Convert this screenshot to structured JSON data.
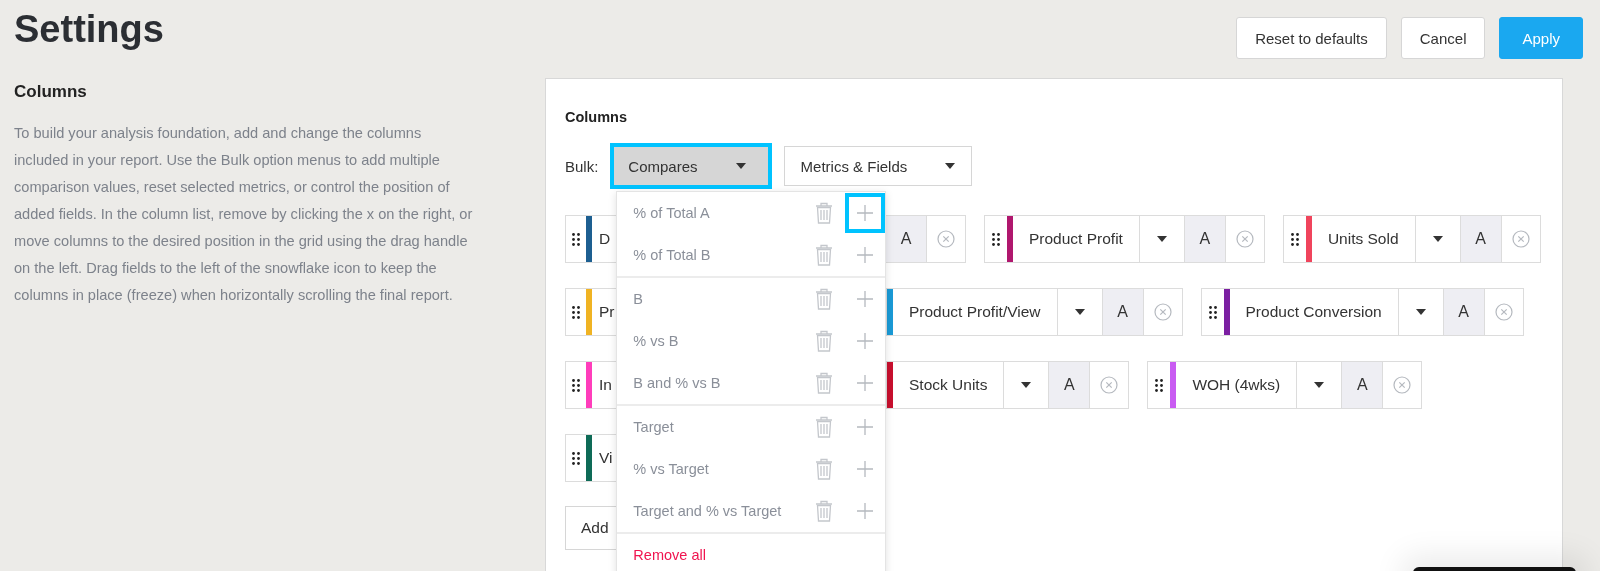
{
  "page": {
    "title": "Settings",
    "buttons": [
      {
        "label": "Reset to defaults",
        "kind": "secondary"
      },
      {
        "label": "Cancel",
        "kind": "secondary"
      },
      {
        "label": "Apply",
        "kind": "primary"
      }
    ]
  },
  "sidebar": {
    "heading": "Columns",
    "description": "To build your analysis foundation, add and change the columns included in your report. Use the Bulk option menus to add multiple comparison values, reset selected metrics, or control the position of added fields. In the column list, remove by clicking the x on the right, or move columns to the desired position in the grid using the drag handle on the left. Drag fields to the left of the snowflake icon to keep the columns in place (freeze) when horizontally scrolling the final report."
  },
  "panel": {
    "heading": "Columns",
    "bulk_label": "Bulk:",
    "bulk_menus": [
      {
        "label": "Compares",
        "open": true,
        "highlighted": true
      },
      {
        "label": "Metrics & Fields",
        "open": false,
        "highlighted": false
      }
    ],
    "column_rows": [
      [
        {
          "label": "D",
          "variant": "A",
          "color": "#1d5f91",
          "kind": "left_a"
        },
        {
          "label": "Product Profit",
          "variant": "A",
          "color": "#b0176e",
          "kind": "full"
        },
        {
          "label": "Units Sold",
          "variant": "A",
          "color": "#f0445c",
          "kind": "full"
        }
      ],
      [
        {
          "label": "Pr",
          "color": "#f0b323",
          "kind": "left"
        },
        {
          "label": "Product Profit/View",
          "variant": "A",
          "color": "#1a9ad6",
          "kind": "right"
        },
        {
          "label": "Product Conversion",
          "variant": "A",
          "color": "#7b1fa2",
          "kind": "full"
        }
      ],
      [
        {
          "label": "In",
          "color": "#ff3dbb",
          "kind": "left"
        },
        {
          "label": "Stock Units",
          "variant": "A",
          "color": "#c8102e",
          "kind": "right"
        },
        {
          "label": "WOH (4wks)",
          "variant": "A",
          "color": "#c95cf2",
          "kind": "full"
        }
      ],
      [
        {
          "label": "Vi",
          "color": "#0e6b57",
          "kind": "left"
        }
      ]
    ],
    "add_button": "Add",
    "compares_menu": {
      "items": [
        {
          "label": "% of Total A",
          "divider_before": false,
          "add_highlighted": true
        },
        {
          "label": "% of Total B",
          "divider_before": false,
          "add_highlighted": false
        },
        {
          "label": "B",
          "divider_before": true,
          "add_highlighted": false
        },
        {
          "label": "% vs B",
          "divider_before": false,
          "add_highlighted": false
        },
        {
          "label": "B and % vs B",
          "divider_before": false,
          "add_highlighted": false
        },
        {
          "label": "Target",
          "divider_before": true,
          "add_highlighted": false
        },
        {
          "label": "% vs Target",
          "divider_before": false,
          "add_highlighted": false
        },
        {
          "label": "Target and % vs Target",
          "divider_before": false,
          "add_highlighted": false
        }
      ],
      "remove_all": "Remove all"
    }
  }
}
